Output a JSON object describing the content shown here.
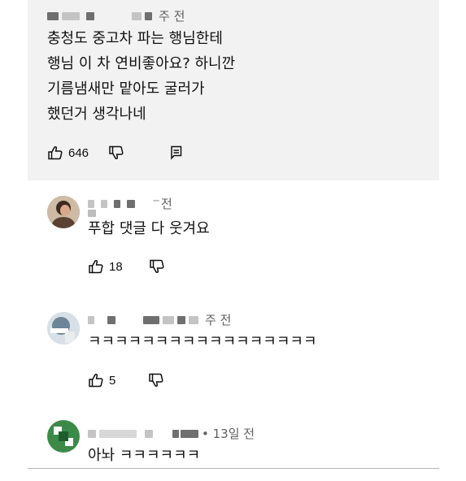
{
  "comments": [
    {
      "time": "주 전",
      "text": "충청도 중고차 파는 행님한테\n행님 이 차 연비좋아요? 하니깐\n기름냄새만 맡아도 굴러가\n했던거 생각나네",
      "likes": "646"
    },
    {
      "time": "전",
      "text": "푸합 댓글 다 웃겨요",
      "likes": "18"
    },
    {
      "time": "주 전",
      "text": "ㅋㅋㅋㅋㅋㅋㅋㅋㅋㅋㅋㅋㅋㅋㅋㅋㅋ",
      "likes": "5"
    },
    {
      "time": "• 13일 전",
      "text": "아놔 ㅋㅋㅋㅋㅋㅋ"
    }
  ],
  "icons": {
    "like": "thumbs-up-icon",
    "dislike": "thumbs-down-icon",
    "reply": "reply-icon",
    "avatar": "avatar"
  },
  "colors": {
    "highlight_background": "#f2f2f2",
    "meta_text": "#606060",
    "divider": "#b5b5b5"
  }
}
